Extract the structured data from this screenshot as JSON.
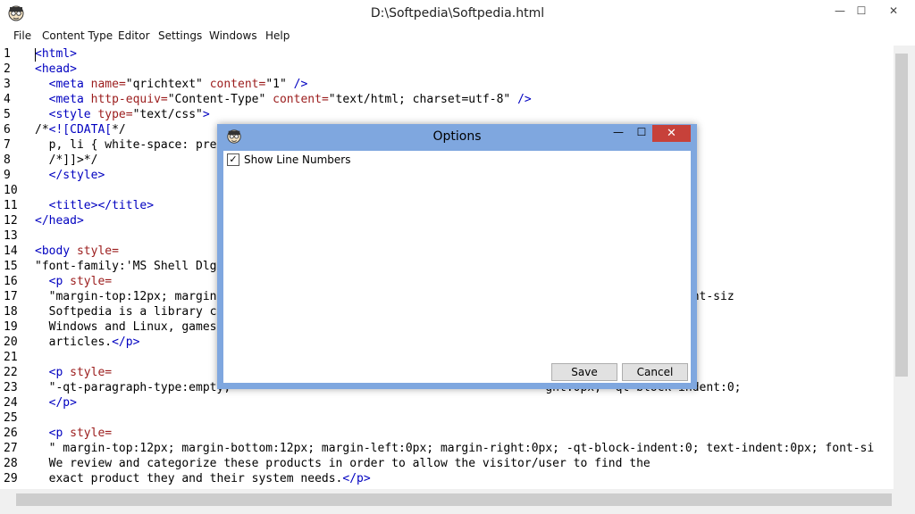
{
  "window": {
    "title": "D:\\Softpedia\\Softpedia.html",
    "minimize_glyph": "—",
    "maximize_glyph": "☐",
    "close_glyph": "✕"
  },
  "menu": [
    "File",
    "Content Type",
    "Editor",
    "Settings",
    "Windows",
    "Help"
  ],
  "editor": {
    "line_numbers": [
      "1",
      "2",
      "3",
      "4",
      "5",
      "6",
      "7",
      "8",
      "9",
      "10",
      "11",
      "12",
      "13",
      "14",
      "15",
      "16",
      "17",
      "18",
      "19",
      "20",
      "21",
      "22",
      "23",
      "24",
      "25",
      "26",
      "27",
      "28",
      "29"
    ],
    "lines": [
      "<html>",
      "<head>",
      "  <meta name=\"qrichtext\" content=\"1\" />",
      "  <meta http-equiv=\"Content-Type\" content=\"text/html; charset=utf-8\" />",
      "  <style type=\"text/css\">",
      "/*<![CDATA[*/",
      "  p, li { white-space: pre",
      "  /*]]>*/",
      "  </style>",
      "",
      "  <title></title>",
      "</head>",
      "",
      "<body style=",
      "\"font-family:'MS Shell Dlg",
      "  <p style=",
      "  \"margin-top:12px; margin                                              0; text-indent:0px; font-siz",
      "  Softpedia is a library c",
      "  Windows and Linux, games",
      "  articles.</p>",
      "",
      "  <p style=",
      "  \"-qt-paragraph-type:empty;                                             ght:0px; -qt-block-indent:0;",
      "  </p>",
      "",
      "  <p style=",
      "  \" margin-top:12px; margin-bottom:12px; margin-left:0px; margin-right:0px; -qt-block-indent:0; text-indent:0px; font-si",
      "  We review and categorize these products in order to allow the visitor/user to find the",
      "  exact product they and their system needs.</p>"
    ]
  },
  "dialog": {
    "title": "Options",
    "minimize_glyph": "—",
    "maximize_glyph": "☐",
    "close_glyph": "✕",
    "show_line_numbers_label": "Show Line Numbers",
    "show_line_numbers_checked": true,
    "check_glyph": "✓",
    "save_label": "Save",
    "cancel_label": "Cancel"
  },
  "colors": {
    "tag": "#0000c0",
    "attribute": "#9b1c1c",
    "dialog_frame": "#7fa7df",
    "close_button": "#c7413a"
  }
}
